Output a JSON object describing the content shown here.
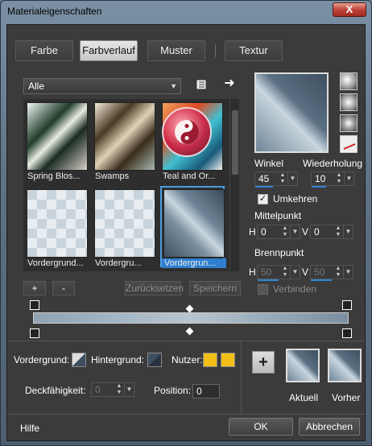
{
  "window": {
    "title": "Materialeigenschaften",
    "close": "X"
  },
  "tabs": [
    {
      "label": "Farbe"
    },
    {
      "label": "Farbverlauf"
    },
    {
      "label": "Muster"
    },
    {
      "label": "Textur"
    }
  ],
  "category": {
    "selected": "Alle"
  },
  "gradients": [
    {
      "name": "Spring Blos..."
    },
    {
      "name": "Swamps"
    },
    {
      "name": "Teal and Or..."
    },
    {
      "name": "Vordergrund..."
    },
    {
      "name": "Vordergru..."
    },
    {
      "name": "Vordergrun..."
    }
  ],
  "settings": {
    "winkel_label": "Winkel",
    "winkel_value": "45",
    "wiederholung_label": "Wiederholung",
    "wiederholung_value": "10",
    "umkehren_label": "Umkehren",
    "umkehren_checked": true,
    "mittelpunkt_label": "Mittelpunkt",
    "mittel_h_label": "H",
    "mittel_h": "0",
    "mittel_v_label": "V",
    "mittel_v": "0",
    "brennpunkt_label": "Brennpunkt",
    "brenn_h_label": "H",
    "brenn_h": "50",
    "brenn_v_label": "V",
    "brenn_v": "50",
    "verbinden_label": "Verbinden"
  },
  "editor": {
    "plus": "+",
    "minus": "-",
    "reset": "Zurücksetzen",
    "save": "Speichern"
  },
  "stops": {
    "vordergrund_label": "Vordergrund:",
    "hintergrund_label": "Hintergrund:",
    "nutzer_label": "Nutzer:",
    "deckfahigkeit_label": "Deckfähigkeit:",
    "deckfahigkeit_value": "0",
    "position_label": "Position:",
    "position_value": "0",
    "nutzer_color": "#f2c018"
  },
  "compare": {
    "add": "+",
    "aktuell": "Aktuell",
    "vorher": "Vorher"
  },
  "footer": {
    "help": "Hilfe",
    "ok": "OK",
    "cancel": "Abbrechen"
  },
  "colors": {
    "accent": "#2f86d6",
    "selection": "#2f7ed0"
  }
}
